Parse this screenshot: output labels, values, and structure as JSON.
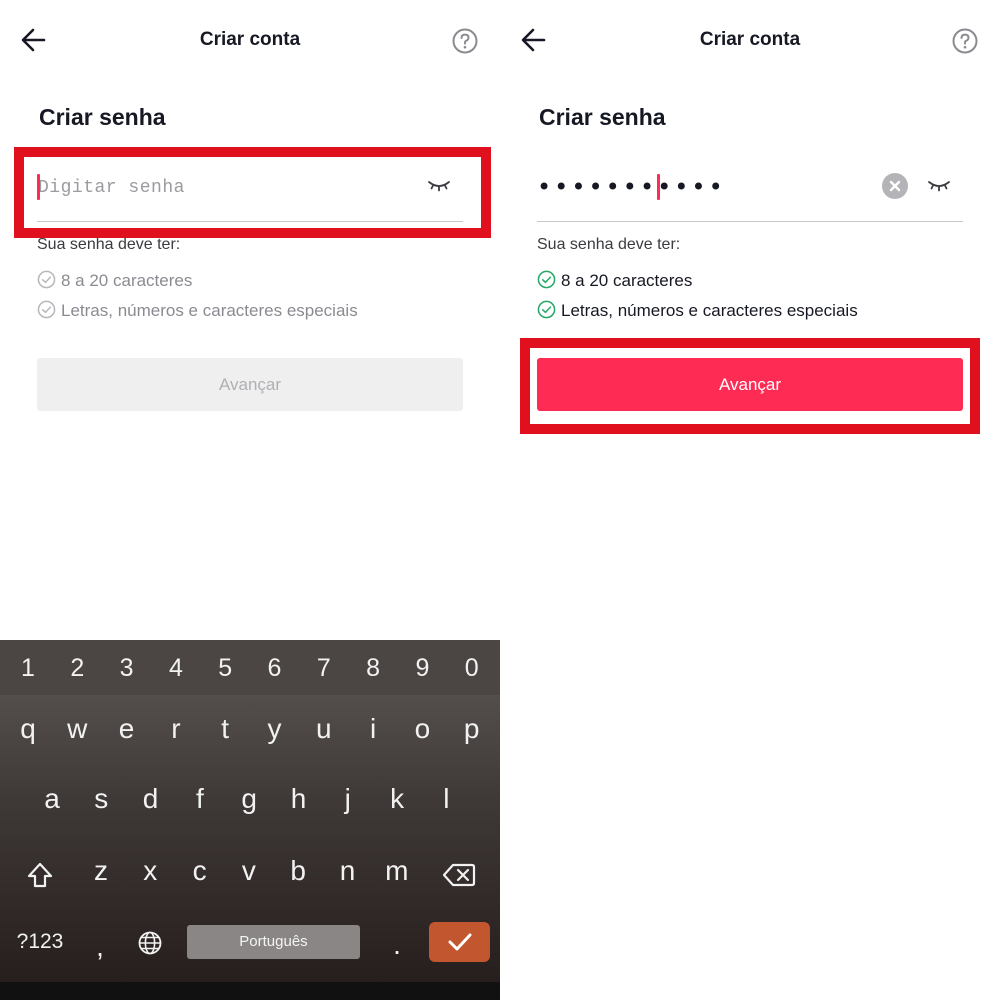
{
  "left_screen": {
    "header": {
      "title": "Criar conta",
      "back_icon": "arrow-left-icon",
      "help_icon": "question-circle-icon"
    },
    "heading": "Criar senha",
    "password_field": {
      "placeholder": "Digitar senha",
      "value": "",
      "eye_icon": "eye-closed-icon"
    },
    "rules_title": "Sua senha deve ter:",
    "rules": [
      {
        "text": "8 a 20 caracteres",
        "satisfied": false
      },
      {
        "text": "Letras, números e caracteres especiais",
        "satisfied": false
      }
    ],
    "next_button": {
      "label": "Avançar",
      "enabled": false
    },
    "keyboard": {
      "number_row": [
        "1",
        "2",
        "3",
        "4",
        "5",
        "6",
        "7",
        "8",
        "9",
        "0"
      ],
      "row1": [
        "q",
        "w",
        "e",
        "r",
        "t",
        "y",
        "u",
        "i",
        "o",
        "p"
      ],
      "row2": [
        "a",
        "s",
        "d",
        "f",
        "g",
        "h",
        "j",
        "k",
        "l"
      ],
      "row3": [
        "z",
        "x",
        "c",
        "v",
        "b",
        "n",
        "m"
      ],
      "symbols_key": "?123",
      "comma_key": ",",
      "period_key": ".",
      "space_label": "Português",
      "shift_icon": "shift-icon",
      "backspace_icon": "backspace-icon",
      "globe_icon": "globe-icon",
      "enter_icon": "checkmark-icon"
    }
  },
  "right_screen": {
    "header": {
      "title": "Criar conta",
      "back_icon": "arrow-left-icon",
      "help_icon": "question-circle-icon"
    },
    "heading": "Criar senha",
    "password_field": {
      "masked_value": "•••••••••••",
      "clear_icon": "clear-icon",
      "eye_icon": "eye-closed-icon"
    },
    "rules_title": "Sua senha deve ter:",
    "rules": [
      {
        "text": "8 a 20 caracteres",
        "satisfied": true
      },
      {
        "text": "Letras, números e caracteres especiais",
        "satisfied": true
      }
    ],
    "next_button": {
      "label": "Avançar",
      "enabled": true
    }
  },
  "colors": {
    "accent": "#fe2c55",
    "highlight_box": "#e0101e",
    "check_ok": "#25a867",
    "check_pending": "#b8b8bc",
    "enter_key": "#c2562e"
  }
}
